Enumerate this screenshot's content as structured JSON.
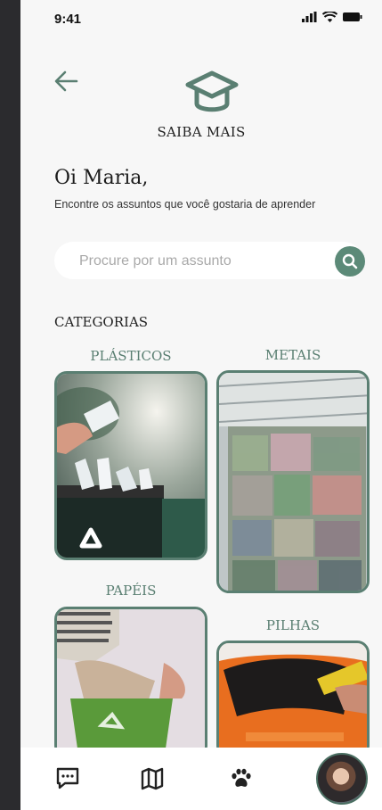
{
  "status_bar": {
    "time": "9:41"
  },
  "header": {
    "title": "SAIBA MAIS"
  },
  "greeting": {
    "title": "Oi Maria,",
    "subtitle": "Encontre os assuntos que você gostaria de aprender"
  },
  "search": {
    "placeholder": "Procure por um assunto",
    "value": ""
  },
  "categories": {
    "heading": "CATEGORIAS",
    "items": [
      {
        "label": "PLÁSTICOS"
      },
      {
        "label": "METAIS"
      },
      {
        "label": "PAPÉIS"
      },
      {
        "label": "PILHAS"
      }
    ]
  },
  "colors": {
    "accent": "#5a7f72",
    "background": "#f7f7f7"
  },
  "bottom_nav": {
    "items": [
      {
        "icon": "chat-icon"
      },
      {
        "icon": "map-icon"
      },
      {
        "icon": "paw-icon"
      },
      {
        "icon": "profile-avatar"
      }
    ]
  }
}
